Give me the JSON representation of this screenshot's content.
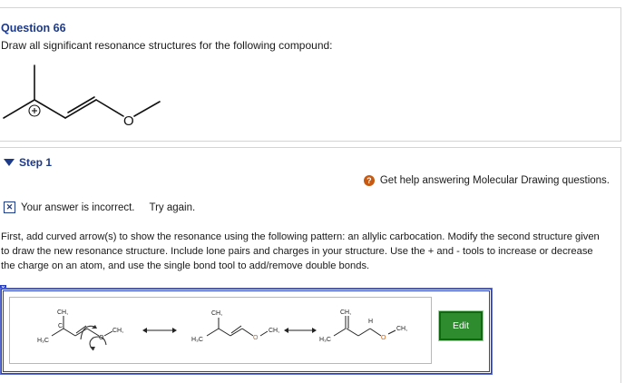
{
  "question": {
    "title": "Question 66",
    "prompt": "Draw all significant resonance structures for the following compound:"
  },
  "step": {
    "label": "Step 1",
    "help_text": "Get help answering Molecular Drawing questions.",
    "help_icon": "question-icon",
    "status_text": "Your answer is incorrect.",
    "retry_text": "Try again.",
    "instructions": "First, add curved arrow(s) to show the resonance using the following pattern: an allylic carbocation. Modify the second structure given to draw the new resonance structure. Include lone pairs and charges in your structure. Use the + and - tools to increase or decrease the charge on an atom, and use the single bond tool to add/remove double bonds."
  },
  "answer": {
    "edit_label": "Edit",
    "close_label": "x",
    "atoms": {
      "ch3": "CH,",
      "h3c": "H₃C",
      "h": "H",
      "c": "C",
      "o": "O"
    }
  },
  "colors": {
    "title_blue": "#1d3a8a",
    "box_blue": "#2a3fbf",
    "edit_green": "#2e8b2e",
    "help_orange": "#c75a10"
  }
}
